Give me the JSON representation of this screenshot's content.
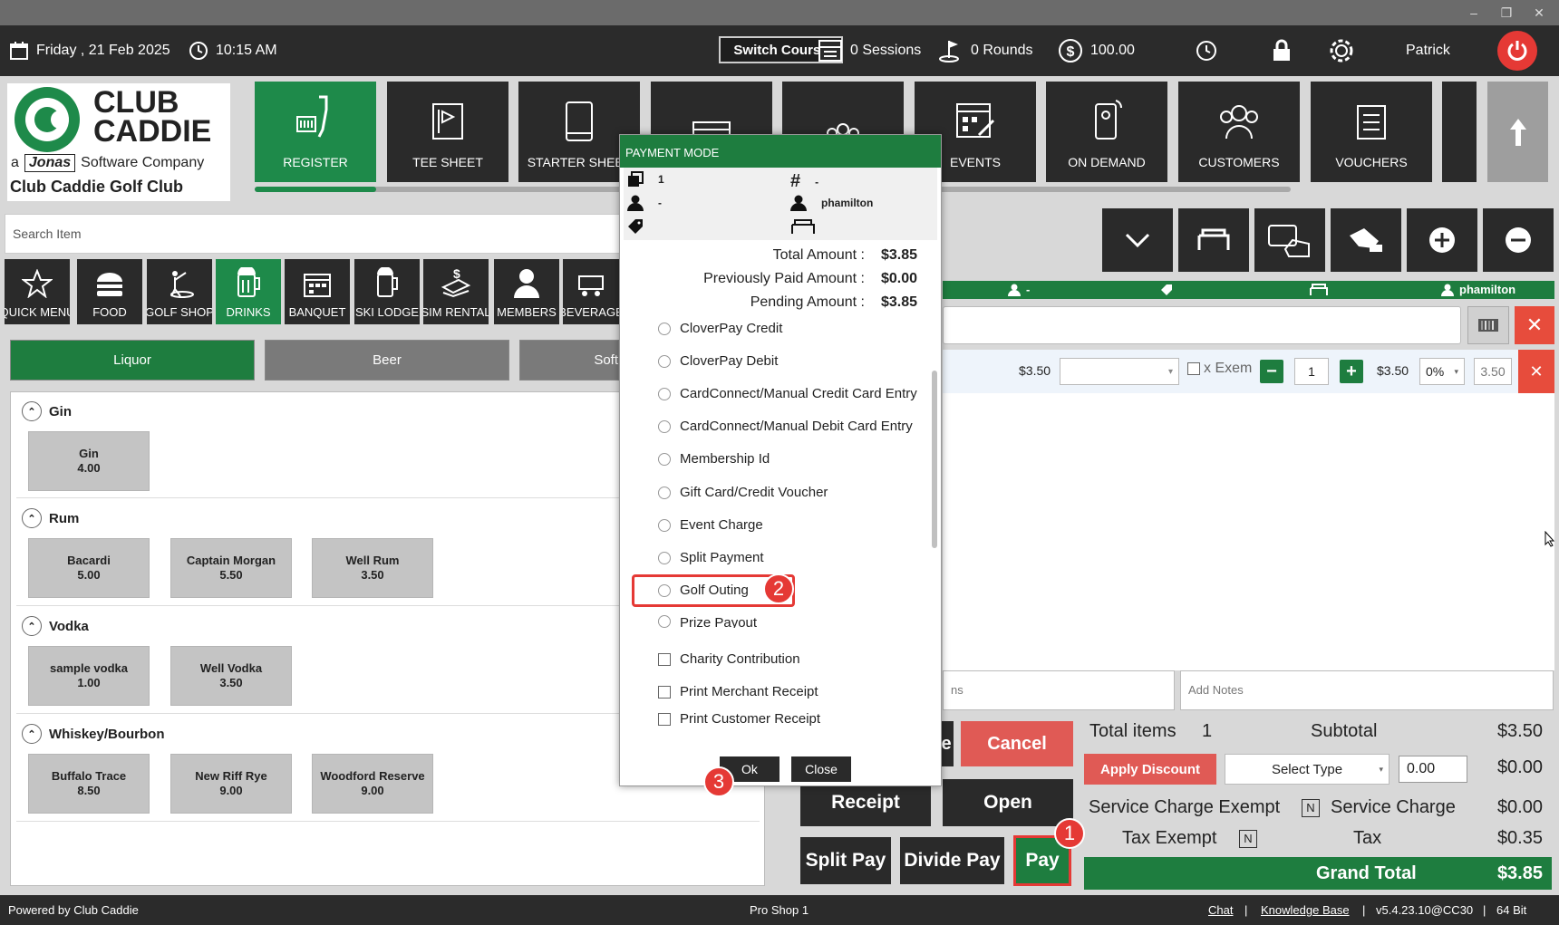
{
  "topbar": {
    "date": "Friday ,  21 Feb 2025",
    "time": "10:15 AM",
    "switch_course": "Switch Course",
    "sessions": "0 Sessions",
    "rounds": "0 Rounds",
    "balance": "100.00",
    "user": "Patrick"
  },
  "logo": {
    "line1": "CLUB",
    "line2": "CADDIE",
    "tag_a": "a",
    "tag_brand": "Jonas",
    "tag_rest": "Software Company",
    "club_name": "Club Caddie Golf Club"
  },
  "nav": [
    {
      "label": "REGISTER",
      "icon": "register-icon"
    },
    {
      "label": "TEE SHEET",
      "icon": "tee-sheet-icon"
    },
    {
      "label": "STARTER SHEET",
      "icon": "tablet-icon"
    },
    {
      "label": "",
      "icon": "calendar-icon"
    },
    {
      "label": "",
      "icon": "group-icon"
    },
    {
      "label": "EVENTS",
      "icon": "events-icon"
    },
    {
      "label": "ON DEMAND",
      "icon": "mobile-icon"
    },
    {
      "label": "CUSTOMERS",
      "icon": "customers-icon"
    },
    {
      "label": "VOUCHERS",
      "icon": "voucher-icon"
    }
  ],
  "search": {
    "placeholder": "Search Item"
  },
  "categories": [
    {
      "label": "QUICK MENU",
      "icon": "star-icon"
    },
    {
      "label": "FOOD",
      "icon": "burger-icon"
    },
    {
      "label": "GOLF SHOP",
      "icon": "golfer-icon"
    },
    {
      "label": "DRINKS",
      "icon": "beer-icon"
    },
    {
      "label": "BANQUET",
      "icon": "banquet-icon"
    },
    {
      "label": "SKI LODGE",
      "icon": "mug-icon"
    },
    {
      "label": "SIM RENTAL",
      "icon": "rental-icon"
    },
    {
      "label": "MEMBERS",
      "icon": "member-icon"
    },
    {
      "label": "BEVERAGE",
      "icon": "cart-icon"
    }
  ],
  "subcats": [
    "Liquor",
    "Beer",
    "Soft"
  ],
  "groups": [
    {
      "name": "Gin",
      "items": [
        {
          "name": "Gin",
          "price": "4.00"
        }
      ]
    },
    {
      "name": "Rum",
      "items": [
        {
          "name": "Bacardi",
          "price": "5.00"
        },
        {
          "name": "Captain Morgan",
          "price": "5.50"
        },
        {
          "name": "Well Rum",
          "price": "3.50"
        }
      ]
    },
    {
      "name": "Vodka",
      "items": [
        {
          "name": "sample vodka",
          "price": "1.00"
        },
        {
          "name": "Well Vodka",
          "price": "3.50"
        }
      ]
    },
    {
      "name": "Whiskey/Bourbon",
      "items": [
        {
          "name": "Buffalo Trace",
          "price": "8.50"
        },
        {
          "name": "New Riff Rye",
          "price": "9.00"
        },
        {
          "name": "Woodford Reserve",
          "price": "9.00"
        }
      ]
    }
  ],
  "order": {
    "head_user": "-",
    "head_name": "phamilton",
    "row": {
      "price": "$3.50",
      "exempt": "x Exem",
      "qty": "1",
      "total": "$3.50",
      "disc": "0%",
      "net": "3.50"
    }
  },
  "notes": {
    "left": "ns",
    "right": "Add Notes"
  },
  "buttons": {
    "partial": "e",
    "cancel": "Cancel",
    "receipt": "Receipt",
    "open": "Open",
    "split_pay": "Split Pay",
    "divide_pay": "Divide Pay",
    "pay": "Pay"
  },
  "totals": {
    "total_items_label": "Total items",
    "total_items": "1",
    "subtotal_label": "Subtotal",
    "subtotal": "$3.50",
    "apply_discount": "Apply Discount",
    "select_type": "Select Type",
    "discount_input": "0.00",
    "discount": "$0.00",
    "svc_exempt_label": "Service Charge Exempt",
    "svc_exempt": "N",
    "svc_label": "Service Charge",
    "svc": "$0.00",
    "tax_exempt_label": "Tax Exempt",
    "tax_exempt": "N",
    "tax_label": "Tax",
    "tax": "$0.35",
    "grand_label": "Grand Total",
    "grand": "$3.85"
  },
  "dialog": {
    "title": "PAYMENT MODE",
    "info": {
      "count": "1",
      "hash": "-",
      "user": "-",
      "name": "phamilton"
    },
    "total_label": "Total Amount :",
    "total": "$3.85",
    "prev_label": "Previously Paid Amount :",
    "prev": "$0.00",
    "pending_label": "Pending Amount :",
    "pending": "$3.85",
    "options": [
      "CloverPay Credit",
      "CloverPay Debit",
      "CardConnect/Manual Credit Card Entry",
      "CardConnect/Manual Debit Card Entry",
      "Membership Id",
      "Gift Card/Credit Voucher",
      "Event Charge",
      "Split Payment",
      "Golf Outing",
      "Prize Payout"
    ],
    "checks": [
      "Charity Contribution",
      "Print Merchant Receipt",
      "Print Customer Receipt"
    ],
    "ok": "Ok",
    "close": "Close"
  },
  "badges": [
    "1",
    "2",
    "3"
  ],
  "footer": {
    "powered": "Powered by Club Caddie",
    "shop": "Pro Shop 1",
    "chat": "Chat",
    "kb": "Knowledge Base",
    "version": "v5.4.23.10@CC30",
    "bits": "64 Bit",
    "sep": "|"
  },
  "colors": {
    "brand_green": "#1e7d3f",
    "accent_red": "#e53935"
  }
}
